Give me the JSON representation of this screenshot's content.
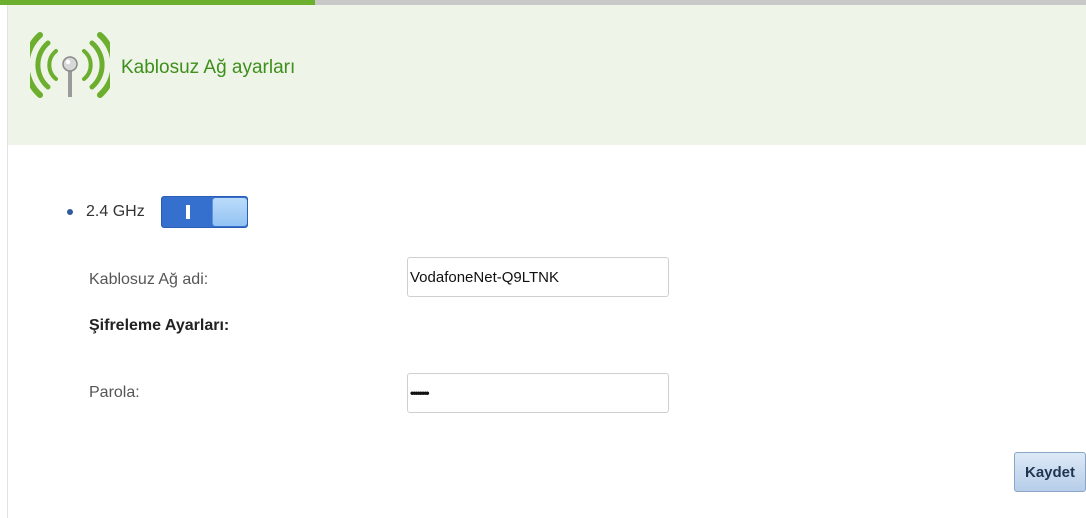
{
  "header": {
    "title": "Kablosuz Ağ ayarları",
    "icon": "wifi-antenna-icon",
    "accent_color": "#6cae2d"
  },
  "progress": {
    "fraction": 0.29
  },
  "band": {
    "label": "2.4 GHz",
    "enabled": true
  },
  "ssid": {
    "label": "Kablosuz Ağ adi:",
    "value": "VodafoneNet-Q9LTNK"
  },
  "encryption": {
    "section_title": "Şifreleme Ayarları:"
  },
  "password": {
    "label": "Parola:",
    "value": "••••••••"
  },
  "actions": {
    "save_label": "Kaydet"
  }
}
